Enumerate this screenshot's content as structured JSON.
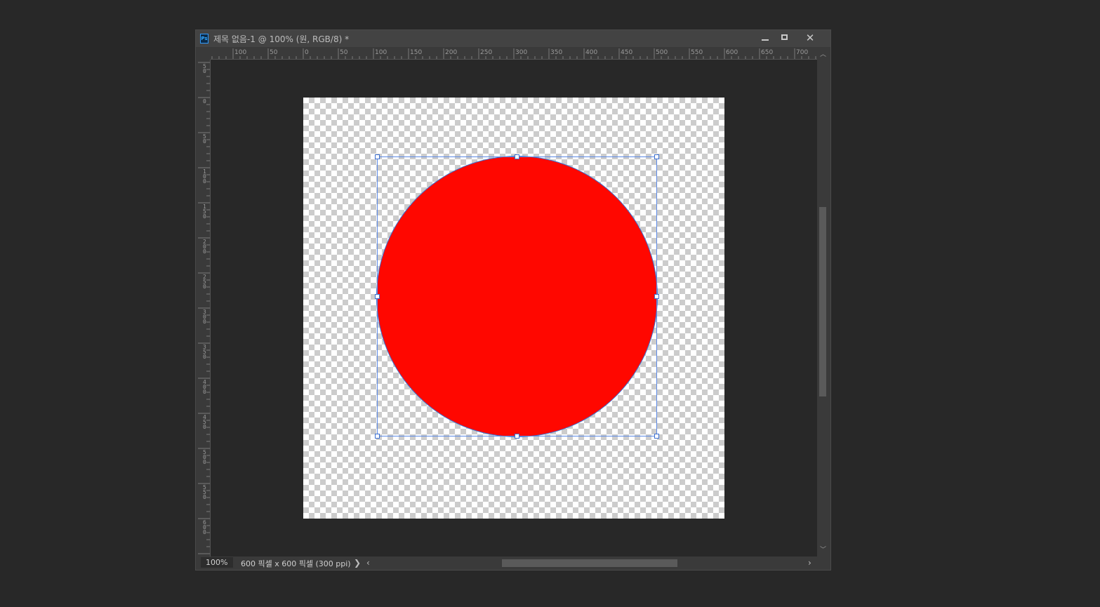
{
  "window": {
    "app_icon": "Ps",
    "title": "제목 없음-1 @ 100% (원, RGB/8) *",
    "controls": {
      "minimize": "minimize-icon",
      "maximize": "maximize-icon",
      "close": "✕"
    }
  },
  "rulers": {
    "horizontal": [
      "100",
      "50",
      "0",
      "50",
      "100",
      "150",
      "200",
      "250",
      "300",
      "350",
      "400",
      "450",
      "500",
      "550",
      "600",
      "650",
      "700"
    ],
    "vertical": [
      "50",
      "0",
      "50",
      "100",
      "150",
      "200",
      "250",
      "300",
      "350",
      "400",
      "450",
      "500",
      "550",
      "600"
    ]
  },
  "document": {
    "canvas_background": "transparent-checkerboard",
    "shape": {
      "type": "ellipse",
      "name": "원",
      "fill": "#ff0700",
      "selected": true
    }
  },
  "statusbar": {
    "zoom": "100%",
    "doc_info": "600 픽셀 x 600 픽셀 (300 ppi)",
    "more_arrow": "❯",
    "scroll_left": "‹",
    "scroll_right": "›"
  },
  "colors": {
    "ui_background": "#282828",
    "panel": "#3a3a3a",
    "selection": "#3b6fd0"
  }
}
